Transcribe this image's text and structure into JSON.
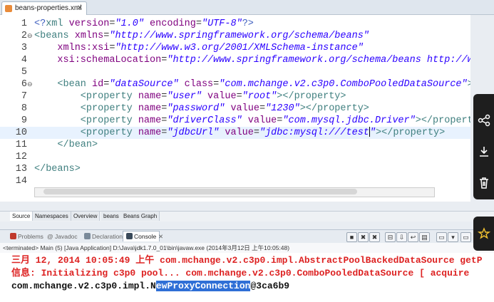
{
  "editor_tab": {
    "title": "beans-properties.xml",
    "close": "✕"
  },
  "code_lines": [
    {
      "n": "1",
      "segments": [
        [
          "pi",
          "<?"
        ],
        [
          "t",
          "xml "
        ],
        [
          "a",
          "version"
        ],
        [
          "p",
          "="
        ],
        [
          "v",
          "\"1.0\""
        ],
        [
          "a",
          " encoding"
        ],
        [
          "p",
          "="
        ],
        [
          "v",
          "\"UTF-8\""
        ],
        [
          "pi",
          "?>"
        ]
      ]
    },
    {
      "n": "2",
      "marker": "⊖",
      "segments": [
        [
          "t",
          "<beans "
        ],
        [
          "a",
          "xmlns"
        ],
        [
          "p",
          "="
        ],
        [
          "v",
          "\"http://www.springframework.org/schema/beans\""
        ]
      ]
    },
    {
      "n": "3",
      "segments": [
        [
          "a",
          "    xmlns:xsi"
        ],
        [
          "p",
          "="
        ],
        [
          "v",
          "\"http://www.w3.org/2001/XMLSchema-instance\""
        ]
      ]
    },
    {
      "n": "4",
      "segments": [
        [
          "a",
          "    xsi:schemaLocation"
        ],
        [
          "p",
          "="
        ],
        [
          "v",
          "\"http://www.springframework.org/schema/beans http://www."
        ]
      ]
    },
    {
      "n": "5",
      "segments": []
    },
    {
      "n": "6",
      "marker": "⊖",
      "segments": [
        [
          "t",
          "    <bean "
        ],
        [
          "a",
          "id"
        ],
        [
          "p",
          "="
        ],
        [
          "v",
          "\"dataSource\""
        ],
        [
          "a",
          " class"
        ],
        [
          "p",
          "="
        ],
        [
          "v",
          "\"com.mchange.v2.c3p0.ComboPooledDataSource\""
        ],
        [
          "t",
          ">"
        ]
      ]
    },
    {
      "n": "7",
      "segments": [
        [
          "t",
          "        <property "
        ],
        [
          "a",
          "name"
        ],
        [
          "p",
          "="
        ],
        [
          "v",
          "\"user\""
        ],
        [
          "a",
          " value"
        ],
        [
          "p",
          "="
        ],
        [
          "v",
          "\"root\""
        ],
        [
          "t",
          "></property>"
        ]
      ]
    },
    {
      "n": "8",
      "segments": [
        [
          "t",
          "        <property "
        ],
        [
          "a",
          "name"
        ],
        [
          "p",
          "="
        ],
        [
          "v",
          "\"password\""
        ],
        [
          "a",
          " value"
        ],
        [
          "p",
          "="
        ],
        [
          "v",
          "\"1230\""
        ],
        [
          "t",
          "></property>"
        ]
      ]
    },
    {
      "n": "9",
      "segments": [
        [
          "t",
          "        <property "
        ],
        [
          "a",
          "name"
        ],
        [
          "p",
          "="
        ],
        [
          "v",
          "\"driverClass\""
        ],
        [
          "a",
          " value"
        ],
        [
          "p",
          "="
        ],
        [
          "v",
          "\"com.mysql.jdbc.Driver\""
        ],
        [
          "t",
          "></property>"
        ]
      ]
    },
    {
      "n": "10",
      "current": true,
      "segments": [
        [
          "t",
          "        <property "
        ],
        [
          "a",
          "name"
        ],
        [
          "p",
          "="
        ],
        [
          "v",
          "\"jdbcUrl\""
        ],
        [
          "a",
          " value"
        ],
        [
          "p",
          "="
        ],
        [
          "v",
          "\"jdbc:mysql:///test"
        ],
        [
          "cursor",
          ""
        ],
        [
          "v",
          "\""
        ],
        [
          "t",
          "></property>"
        ]
      ]
    },
    {
      "n": "11",
      "segments": [
        [
          "t",
          "    </bean>"
        ]
      ]
    },
    {
      "n": "12",
      "segments": []
    },
    {
      "n": "13",
      "segments": [
        [
          "t",
          "</beans>"
        ]
      ]
    },
    {
      "n": "14",
      "segments": []
    }
  ],
  "source_tabs": [
    "Source",
    "Namespaces",
    "Overview",
    "beans",
    "Beans Graph"
  ],
  "console_tabs": [
    {
      "label": "Problems",
      "color": "#c0392b"
    },
    {
      "label": "@ Javadoc",
      "color": ""
    },
    {
      "label": "Declaration",
      "color": "#7a8a9a"
    },
    {
      "label": "Console",
      "color": "#3a4a5a",
      "active": true
    },
    {
      "label": "✕",
      "color": ""
    }
  ],
  "terminated_line": "<terminated> Main (5) [Java Application] D:\\Java\\jdk1.7.0_01\\bin\\javaw.exe (2014年3月12日 上午10:05:48)",
  "console_lines": [
    {
      "style": "red",
      "text": "三月 12, 2014 10:05:49 上午 com.mchange.v2.c3p0.impl.AbstractPoolBackedDataSource getP"
    },
    {
      "style": "red",
      "text": "信息: Initializing c3p0 pool... com.mchange.v2.c3p0.ComboPooledDataSource [ acquire"
    },
    {
      "style": "blk",
      "pre": "com.mchange.v2.c3p0.impl.N",
      "sel": "ewProxyConnection",
      "post": "@3ca6b9"
    }
  ],
  "colors": {
    "tag": "#3f7f7f",
    "attr": "#7f007f",
    "value": "#2a00ff",
    "error": "#d22222",
    "selection": "#2f6fd6"
  }
}
